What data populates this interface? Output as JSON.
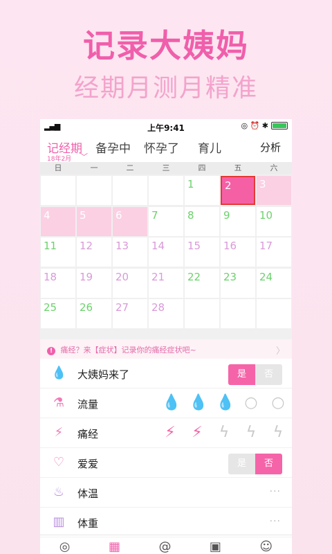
{
  "promo": {
    "title": "记录大姨妈",
    "subtitle": "经期月测月精准"
  },
  "status": {
    "signal": "▂▄▆",
    "wifi": "≋",
    "time": "上午9:41",
    "icons": "◎ ⏰ ✱"
  },
  "tabs": [
    {
      "label": "记经期",
      "active": true
    },
    {
      "label": "备孕中"
    },
    {
      "label": "怀孕了"
    },
    {
      "label": "育儿"
    }
  ],
  "tab_date": "18年2月",
  "tab_chevron": "﹀",
  "analysis": "分析",
  "weekdays": [
    "日",
    "一",
    "二",
    "三",
    "四",
    "五",
    "六"
  ],
  "calendar": {
    "days": [
      "",
      "",
      "",
      "",
      "1",
      "2",
      "3",
      "4",
      "5",
      "6",
      "7",
      "8",
      "9",
      "10",
      "11",
      "12",
      "13",
      "14",
      "15",
      "16",
      "17",
      "18",
      "19",
      "20",
      "21",
      "22",
      "23",
      "24",
      "25",
      "26",
      "27",
      "28",
      "",
      "",
      ""
    ]
  },
  "tip": {
    "icon": "!",
    "text": "痛经？来【症状】记录你的痛经症状吧~",
    "arrow": "〉"
  },
  "rows": {
    "period": {
      "label": "大姨妈来了",
      "yes": "是",
      "no": "否",
      "selected": "是"
    },
    "flow": {
      "label": "流量",
      "level": 3,
      "max": 5
    },
    "pain": {
      "label": "痛经",
      "level": 2,
      "max": 5
    },
    "love": {
      "label": "爱爱",
      "yes": "是",
      "no": "否",
      "selected": "否"
    },
    "temp": {
      "label": "体温",
      "more": "···"
    },
    "weight": {
      "label": "体重",
      "more": "···"
    }
  },
  "colors": {
    "accent": "#f05fab",
    "period_bg": "#fbd0e3",
    "today_bg": "#f560a5"
  }
}
